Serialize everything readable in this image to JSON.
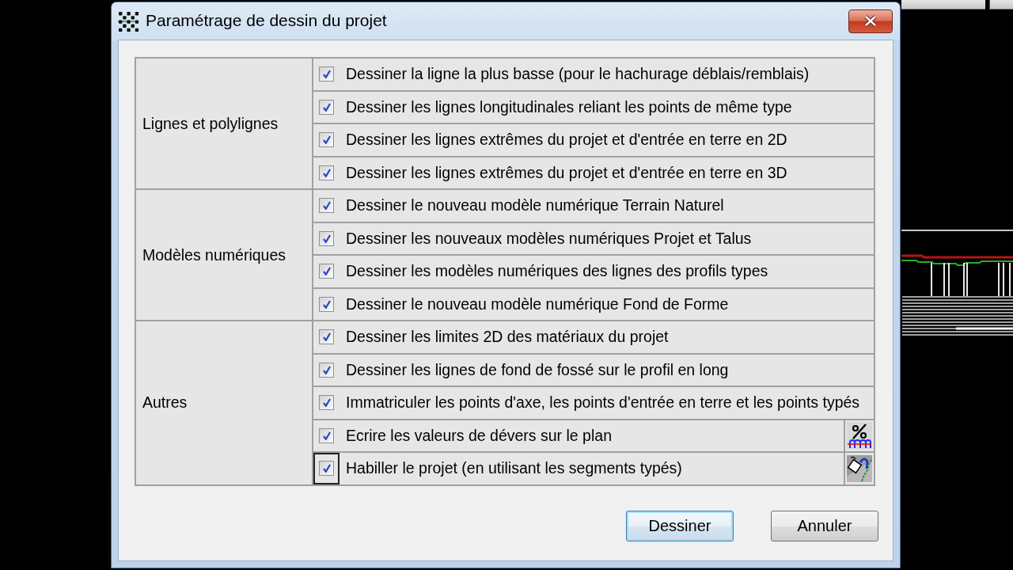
{
  "window": {
    "title": "Paramétrage de dessin du projet"
  },
  "groups": [
    {
      "label": "Lignes et polylignes",
      "options": [
        {
          "kind": "plain",
          "label": "Dessiner la ligne la plus basse (pour le hachurage déblais/remblais)",
          "checked": true,
          "focused": false
        },
        {
          "kind": "plain",
          "label": "Dessiner les lignes longitudinales reliant les points de même type",
          "checked": true,
          "focused": false
        },
        {
          "kind": "plain",
          "label": "Dessiner les lignes extrêmes du projet et d'entrée en terre en 2D",
          "checked": true,
          "focused": false
        },
        {
          "kind": "plain",
          "label": "Dessiner les lignes extrêmes du projet et d'entrée en terre en 3D",
          "checked": true,
          "focused": false
        }
      ]
    },
    {
      "label": "Modèles numériques",
      "options": [
        {
          "kind": "plain",
          "label": "Dessiner le nouveau modèle numérique Terrain Naturel",
          "checked": true,
          "focused": false
        },
        {
          "kind": "plain",
          "label": "Dessiner les nouveaux modèles numériques Projet et Talus",
          "checked": true,
          "focused": false
        },
        {
          "kind": "plain",
          "label": "Dessiner les modèles numériques des lignes des profils types",
          "checked": true,
          "focused": false
        },
        {
          "kind": "plain",
          "label": "Dessiner le nouveau modèle numérique Fond de Forme",
          "checked": true,
          "focused": false
        }
      ]
    },
    {
      "label": "Autres",
      "options": [
        {
          "kind": "plain",
          "label": "Dessiner les limites 2D des matériaux du projet",
          "checked": true,
          "focused": false
        },
        {
          "kind": "plain",
          "label": "Dessiner les lignes de fond de fossé sur le profil en long",
          "checked": true,
          "focused": false
        },
        {
          "kind": "plain",
          "label": "Immatriculer les points d'axe, les points d'entrée en terre et les points typés",
          "checked": true,
          "focused": false
        },
        {
          "kind": "slope_tool",
          "label": "Ecrire les valeurs de dévers sur le plan",
          "checked": true,
          "focused": false
        },
        {
          "kind": "dressing_tool",
          "label": "Habiller le projet (en utilisant les segments typés)",
          "checked": true,
          "focused": true
        }
      ]
    }
  ],
  "buttons": [
    {
      "label": "Dessiner",
      "default": true
    },
    {
      "label": "Annuler",
      "default": false
    }
  ]
}
